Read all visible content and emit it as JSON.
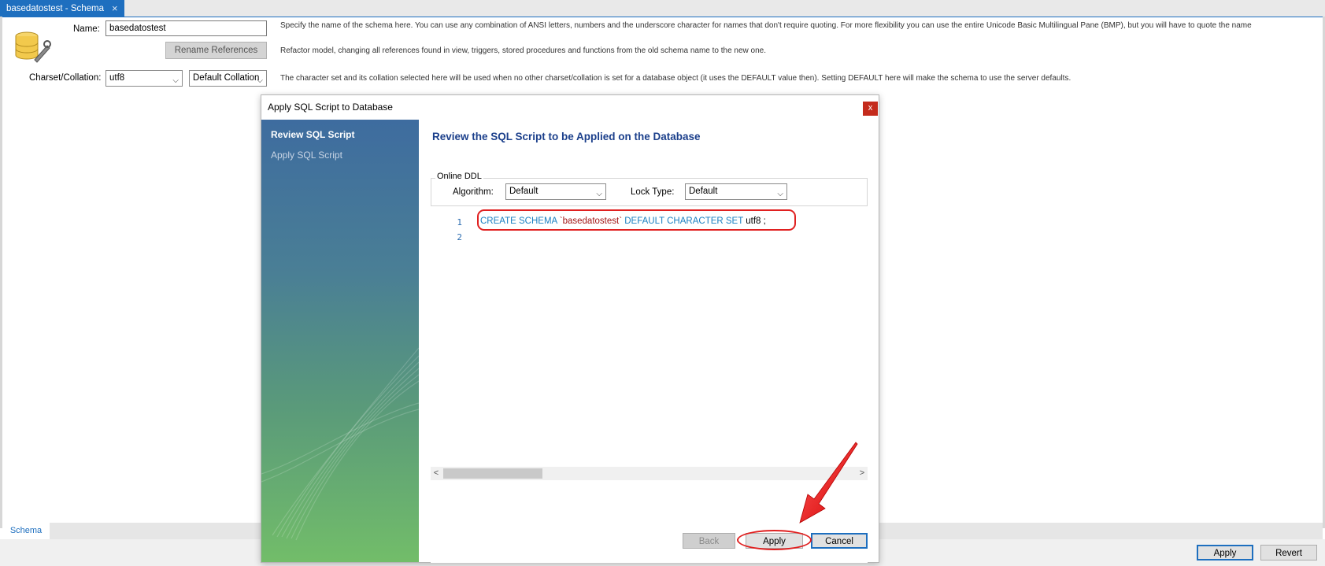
{
  "tab": {
    "title": "basedatostest - Schema",
    "close": "×"
  },
  "form": {
    "name_label": "Name:",
    "name_value": "basedatostest",
    "name_desc": "Specify the name of the schema here. You can use any combination of ANSI letters, numbers and the underscore character for names that don't require quoting. For more flexibility you can use the entire Unicode Basic Multilingual Pane (BMP), but you will have to quote the name",
    "rename_button": "Rename References",
    "rename_desc": "Refactor model, changing all references found in view, triggers, stored procedures and functions from the old schema name to the new one.",
    "charset_label": "Charset/Collation:",
    "charset_value": "utf8",
    "collation_value": "Default Collation",
    "charset_desc": "The character set and its collation selected here will be used when no other charset/collation is set for a database object (it uses the DEFAULT value then). Setting DEFAULT here will make the schema to use the server defaults."
  },
  "dialog": {
    "title": "Apply SQL Script to Database",
    "close": "x",
    "steps": [
      {
        "label": "Review SQL Script",
        "active": true
      },
      {
        "label": "Apply SQL Script",
        "active": false
      }
    ],
    "heading": "Review the SQL Script to be Applied on the Database",
    "online_ddl": {
      "legend": "Online DDL",
      "algorithm_label": "Algorithm:",
      "algorithm_value": "Default",
      "lock_label": "Lock Type:",
      "lock_value": "Default"
    },
    "script": {
      "line_numbers": [
        "1",
        "2"
      ],
      "kw1": "CREATE SCHEMA",
      "name": "`basedatostest`",
      "kw2": "DEFAULT CHARACTER SET",
      "charset": "utf8 ;"
    },
    "scroll_left": "<",
    "scroll_right": ">",
    "buttons": {
      "back": "Back",
      "apply": "Apply",
      "cancel": "Cancel"
    }
  },
  "bottom": {
    "tab": "Schema",
    "apply": "Apply",
    "revert": "Revert"
  },
  "colors": {
    "accent": "#1e6fbf",
    "annotation": "#e02020",
    "heading": "#1b3f8b"
  }
}
